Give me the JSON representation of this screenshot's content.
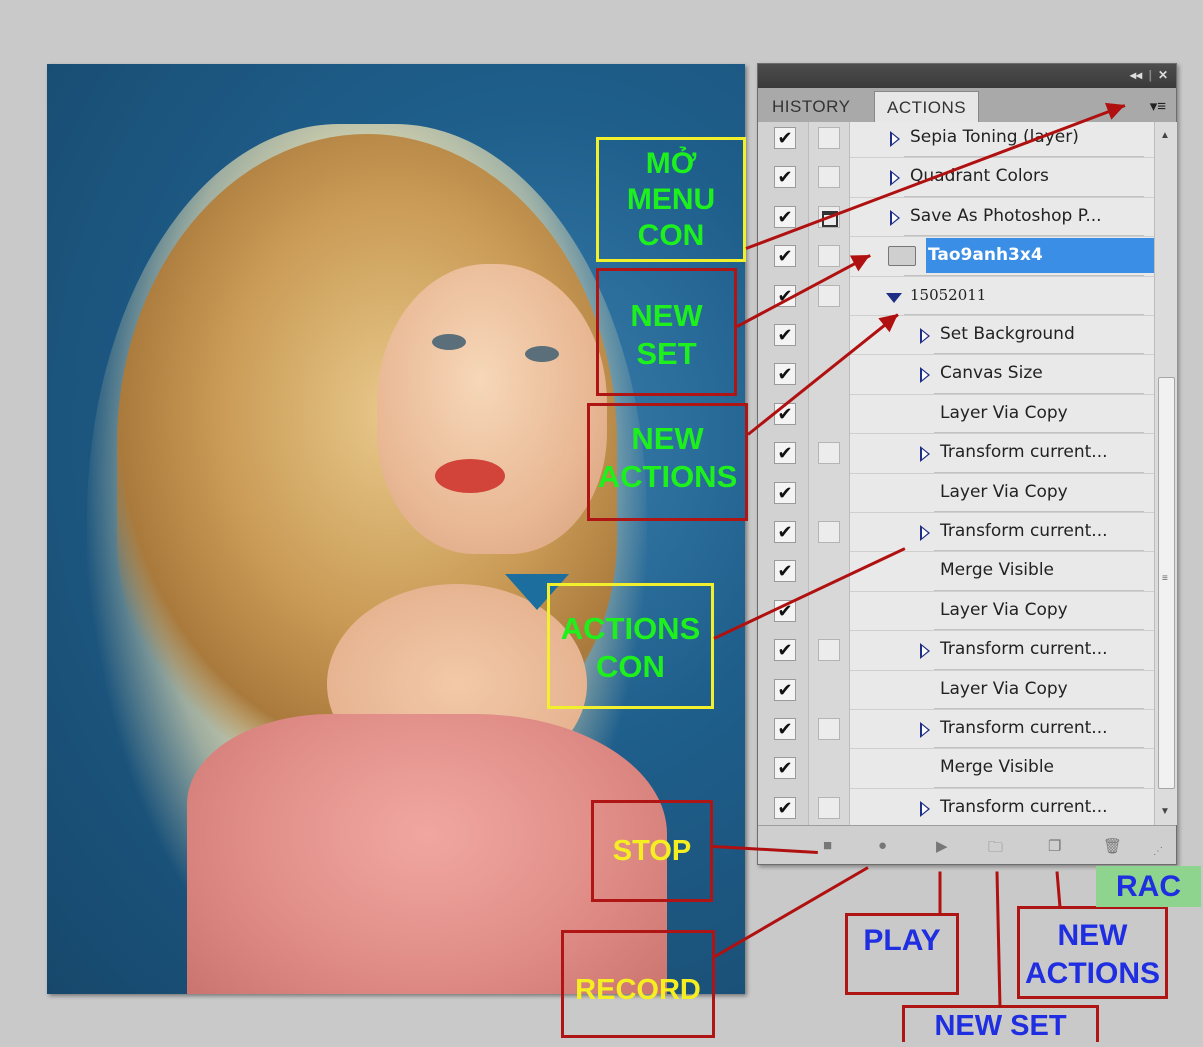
{
  "panel": {
    "tabs": [
      {
        "label": "HISTORY"
      },
      {
        "label": "ACTIONS"
      }
    ],
    "titlebar_controls": [
      "◂◂",
      "|",
      "✕"
    ],
    "menu_icon": "panel-menu-icon",
    "rows": [
      {
        "label": "Sepia Toning (layer)",
        "checked": true,
        "dialog": "none",
        "expander": "collapsed",
        "indent": 1
      },
      {
        "label": "Quadrant Colors",
        "checked": true,
        "dialog": "none",
        "expander": "collapsed",
        "indent": 1
      },
      {
        "label": "Save As Photoshop P...",
        "checked": true,
        "dialog": "on",
        "expander": "collapsed",
        "indent": 1
      },
      {
        "label": "Tao9anh3x4",
        "checked": true,
        "dialog": "none",
        "expander": "folder",
        "indent": 0,
        "selected": true
      },
      {
        "label": "15052011",
        "checked": true,
        "dialog": "none",
        "expander": "expanded",
        "indent": 1
      },
      {
        "label": "Set Background",
        "checked": true,
        "dialog": "none",
        "expander": "collapsed",
        "indent": 2
      },
      {
        "label": "Canvas Size",
        "checked": true,
        "dialog": "none",
        "expander": "collapsed",
        "indent": 2
      },
      {
        "label": "Layer Via Copy",
        "checked": true,
        "dialog": "none",
        "expander": "none",
        "indent": 2
      },
      {
        "label": "Transform current...",
        "checked": true,
        "dialog": "none",
        "expander": "collapsed",
        "indent": 2
      },
      {
        "label": "Layer Via Copy",
        "checked": true,
        "dialog": "none",
        "expander": "none",
        "indent": 2
      },
      {
        "label": "Transform current...",
        "checked": true,
        "dialog": "none",
        "expander": "collapsed",
        "indent": 2
      },
      {
        "label": "Merge Visible",
        "checked": true,
        "dialog": "none",
        "expander": "none",
        "indent": 2
      },
      {
        "label": "Layer Via Copy",
        "checked": true,
        "dialog": "none",
        "expander": "none",
        "indent": 2
      },
      {
        "label": "Transform current...",
        "checked": true,
        "dialog": "none",
        "expander": "collapsed",
        "indent": 2
      },
      {
        "label": "Layer Via Copy",
        "checked": true,
        "dialog": "none",
        "expander": "none",
        "indent": 2
      },
      {
        "label": "Transform current...",
        "checked": true,
        "dialog": "none",
        "expander": "collapsed",
        "indent": 2
      },
      {
        "label": "Merge Visible",
        "checked": true,
        "dialog": "none",
        "expander": "none",
        "indent": 2
      },
      {
        "label": "Transform current...",
        "checked": true,
        "dialog": "none",
        "expander": "collapsed",
        "indent": 2
      }
    ],
    "bottom_buttons": [
      {
        "name": "stop-button",
        "glyph": "■"
      },
      {
        "name": "record-button",
        "glyph": "●"
      },
      {
        "name": "play-button",
        "glyph": "▶"
      },
      {
        "name": "new-set-button",
        "glyph": "🗀"
      },
      {
        "name": "new-action-button",
        "glyph": "❐"
      },
      {
        "name": "delete-button",
        "glyph": "🗑"
      }
    ]
  },
  "annotations": {
    "mo_menu_con": "MỞ MENU CON",
    "new_set_left": "NEW SET",
    "new_actions_left": "NEW ACTIONS",
    "actions_con": "ACTIONS CON",
    "stop": "STOP",
    "record": "RECORD",
    "play": "PLAY",
    "new_set_bottom": "NEW SET",
    "new_actions_bottom": "NEW ACTIONS",
    "rac": "RAC"
  },
  "colors": {
    "annotation_green": "#1df01d",
    "annotation_yellow": "#f5ef22",
    "annotation_blue": "#1e2ee0",
    "box_red": "#b01515",
    "box_yellow": "#f2ef2d",
    "selection_blue": "#3a8ee6"
  }
}
